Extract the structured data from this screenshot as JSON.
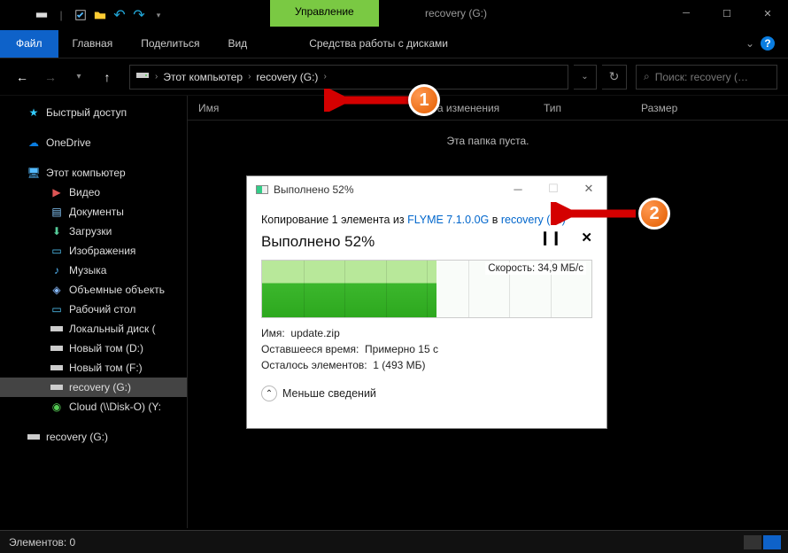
{
  "titlebar": {
    "manage_tab": "Управление",
    "window_title": "recovery (G:)"
  },
  "ribbon": {
    "file": "Файл",
    "home": "Главная",
    "share": "Поделиться",
    "view": "Вид",
    "manage_sub": "Средства работы с дисками"
  },
  "breadcrumb": {
    "root": "Этот компьютер",
    "leaf": "recovery (G:)"
  },
  "search": {
    "placeholder": "Поиск: recovery (…"
  },
  "columns": {
    "name": "Имя",
    "date": "Дата изменения",
    "type": "Тип",
    "size": "Размер"
  },
  "empty_text": "Эта папка пуста.",
  "sidebar": {
    "quick": "Быстрый доступ",
    "onedrive": "OneDrive",
    "this_pc": "Этот компьютер",
    "video": "Видео",
    "docs": "Документы",
    "downloads": "Загрузки",
    "pictures": "Изображения",
    "music": "Музыка",
    "objects3d": "Объемные объекть",
    "desktop": "Рабочий стол",
    "local_c": "Локальный диск (",
    "vol_d": "Новый том (D:)",
    "vol_f": "Новый том (F:)",
    "recovery": "recovery (G:)",
    "cloud": "Cloud (\\\\Disk-O) (Y:",
    "recovery2": "recovery (G:)"
  },
  "statusbar": {
    "elements": "Элементов: 0"
  },
  "copy": {
    "title": "Выполнено 52%",
    "line_pre": "Копирование 1 элемента из ",
    "src": "FLYME 7.1.0.0G",
    "line_mid": " в ",
    "dst": "recovery (G:)",
    "progress_label": "Выполнено 52%",
    "speed": "Скорость: 34,9 МБ/с",
    "meta_name_label": "Имя:",
    "meta_name_val": "update.zip",
    "meta_time_label": "Оставшееся время:",
    "meta_time_val": "Примерно 15 с",
    "meta_items_label": "Осталось элементов:",
    "meta_items_val": "1 (493 МБ)",
    "less": "Меньше сведений"
  },
  "callouts": {
    "one": "1",
    "two": "2"
  }
}
